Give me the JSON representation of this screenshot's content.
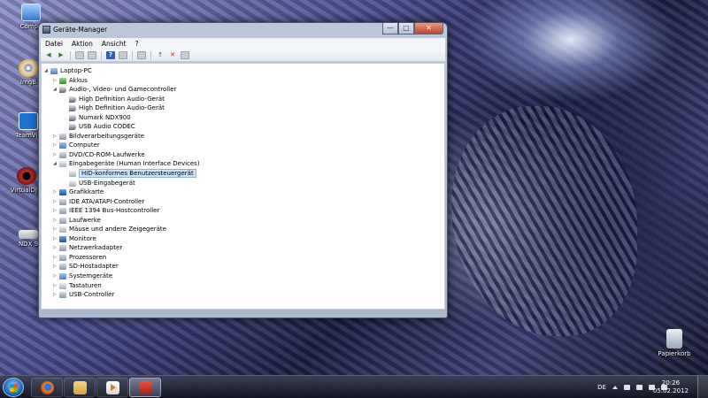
{
  "desktop": {
    "icons": [
      {
        "label": "Compu",
        "icon": "computer-icon"
      },
      {
        "label": "ImgB",
        "icon": "imgburn-icon"
      },
      {
        "label": "TeamVie",
        "icon": "teamviewer-icon"
      },
      {
        "label": "VirtualDJ P",
        "icon": "virtualdj-icon"
      },
      {
        "label": "NDX 9",
        "icon": "ndx-icon"
      },
      {
        "label": "Papierkorb",
        "icon": "recycle-bin-icon"
      }
    ]
  },
  "window": {
    "title": "Geräte-Manager",
    "controls": {
      "minimize": "—",
      "maximize": "□",
      "close": "✕"
    },
    "menu": [
      "Datei",
      "Aktion",
      "Ansicht",
      "?"
    ],
    "toolbar": [
      "back",
      "forward",
      "properties",
      "hide",
      "help",
      "view",
      "scan",
      "update-driver",
      "uninstall",
      "disable"
    ],
    "tree": [
      {
        "label": "Laptop-PC",
        "level": 0,
        "expander": "◢",
        "icon": "pc"
      },
      {
        "label": "Akkus",
        "level": 1,
        "expander": "▷",
        "icon": "battery"
      },
      {
        "label": "Audio-, Video- und Gamecontroller",
        "level": 1,
        "expander": "◢",
        "icon": "sound"
      },
      {
        "label": "High Definition Audio-Gerät",
        "level": 2,
        "expander": "",
        "icon": "sound"
      },
      {
        "label": "High Definition Audio-Gerät",
        "level": 2,
        "expander": "",
        "icon": "sound"
      },
      {
        "label": "Numark NDX900",
        "level": 2,
        "expander": "",
        "icon": "sound"
      },
      {
        "label": "USB Audio CODEC",
        "level": 2,
        "expander": "",
        "icon": "sound"
      },
      {
        "label": "Bildverarbeitungsgeräte",
        "level": 1,
        "expander": "▷",
        "icon": "device"
      },
      {
        "label": "Computer",
        "level": 1,
        "expander": "▷",
        "icon": "pc"
      },
      {
        "label": "DVD/CD-ROM-Laufwerke",
        "level": 1,
        "expander": "▷",
        "icon": "device"
      },
      {
        "label": "Eingabegeräte (Human Interface Devices)",
        "level": 1,
        "expander": "◢",
        "icon": "hid"
      },
      {
        "label": "HID-konformes Benutzersteuergerät",
        "level": 2,
        "expander": "",
        "icon": "hid",
        "selected": true
      },
      {
        "label": "USB-Eingabegerät",
        "level": 2,
        "expander": "",
        "icon": "hid"
      },
      {
        "label": "Grafikkarte",
        "level": 1,
        "expander": "▷",
        "icon": "display"
      },
      {
        "label": "IDE ATA/ATAPI-Controller",
        "level": 1,
        "expander": "▷",
        "icon": "device"
      },
      {
        "label": "IEEE 1394 Bus-Hostcontroller",
        "level": 1,
        "expander": "▷",
        "icon": "device"
      },
      {
        "label": "Laufwerke",
        "level": 1,
        "expander": "▷",
        "icon": "device"
      },
      {
        "label": "Mäuse und andere Zeigegeräte",
        "level": 1,
        "expander": "▷",
        "icon": "hid"
      },
      {
        "label": "Monitore",
        "level": 1,
        "expander": "▷",
        "icon": "display"
      },
      {
        "label": "Netzwerkadapter",
        "level": 1,
        "expander": "▷",
        "icon": "device"
      },
      {
        "label": "Prozessoren",
        "level": 1,
        "expander": "▷",
        "icon": "device"
      },
      {
        "label": "SD-Hostadapter",
        "level": 1,
        "expander": "▷",
        "icon": "device"
      },
      {
        "label": "Systemgeräte",
        "level": 1,
        "expander": "▷",
        "icon": "pc"
      },
      {
        "label": "Tastaturen",
        "level": 1,
        "expander": "▷",
        "icon": "hid"
      },
      {
        "label": "USB-Controller",
        "level": 1,
        "expander": "▷",
        "icon": "device"
      }
    ]
  },
  "taskbar": {
    "items": [
      {
        "name": "firefox",
        "icon": "firefox-icon"
      },
      {
        "name": "explorer",
        "icon": "folder-icon"
      },
      {
        "name": "media-player",
        "icon": "media-player-icon"
      },
      {
        "name": "device-manager",
        "icon": "device-manager-icon",
        "active": true
      }
    ],
    "language": "DE",
    "time": "20:26",
    "date": "05.02.2012"
  }
}
